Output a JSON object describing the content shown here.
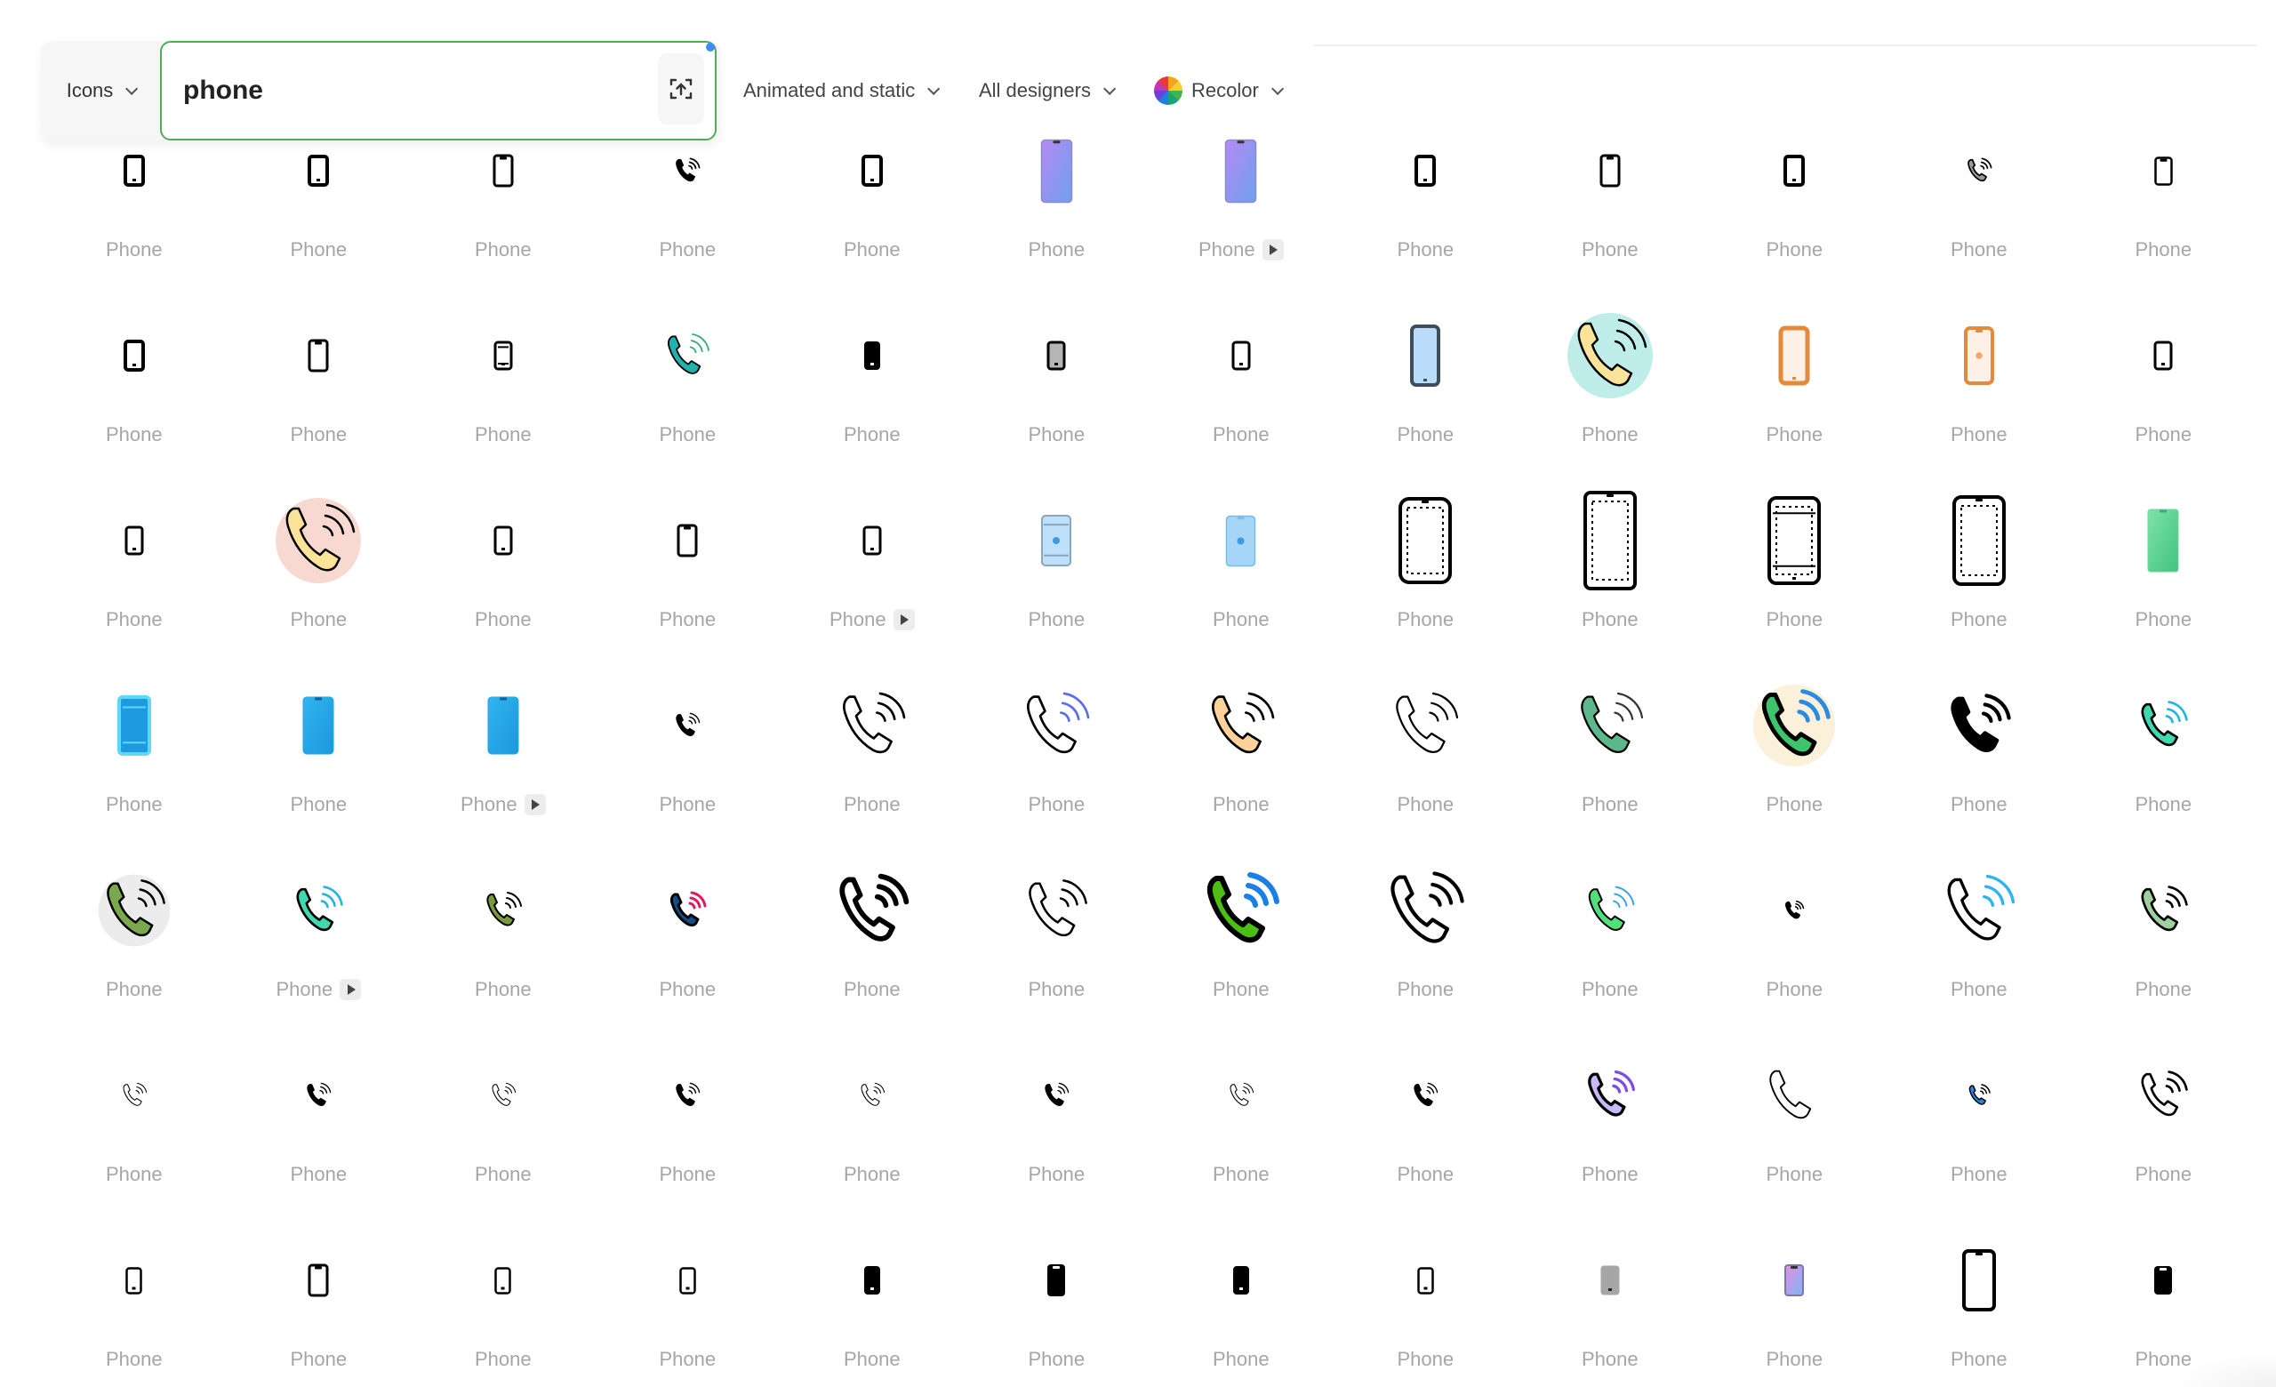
{
  "toolbar": {
    "type_select": "Icons",
    "search": {
      "value": "phone",
      "placeholder": ""
    },
    "upload_icon": "upload-image-icon",
    "filters": [
      {
        "label": "Animated and static"
      },
      {
        "label": "All designers"
      },
      {
        "label": "Recolor",
        "icon": "color-wheel-icon"
      }
    ]
  },
  "accent": {
    "search_border": "#4caf50",
    "notify_dot": "#3d8ef0",
    "label_color": "#a6a6a6"
  },
  "results": [
    {
      "label": "Phone",
      "style": "smartphone-solid"
    },
    {
      "label": "Phone",
      "style": "smartphone-solid"
    },
    {
      "label": "Phone",
      "style": "smartphone-notch-outline"
    },
    {
      "label": "Phone",
      "style": "handset-waves-solid"
    },
    {
      "label": "Phone",
      "style": "smartphone-solid"
    },
    {
      "label": "Phone",
      "style": "smartphone-gradient-purple"
    },
    {
      "label": "Phone",
      "style": "smartphone-gradient-purple",
      "animated": true
    },
    {
      "label": "Phone",
      "style": "smartphone-solid"
    },
    {
      "label": "Phone",
      "style": "smartphone-notch-outline"
    },
    {
      "label": "Phone",
      "style": "smartphone-solid"
    },
    {
      "label": "Phone",
      "style": "handset-waves-gray"
    },
    {
      "label": "Phone",
      "style": "smartphone-outline-thin"
    },
    {
      "label": "Phone",
      "style": "smartphone-solid"
    },
    {
      "label": "Phone",
      "style": "smartphone-notch-outline"
    },
    {
      "label": "Phone",
      "style": "smartphone-keypad"
    },
    {
      "label": "Phone",
      "style": "handset-waves-teal"
    },
    {
      "label": "Phone",
      "style": "smartphone-filled-black"
    },
    {
      "label": "Phone",
      "style": "smartphone-gray-screen"
    },
    {
      "label": "Phone",
      "style": "smartphone-outline-small"
    },
    {
      "label": "Phone",
      "style": "smartphone-blue-screen"
    },
    {
      "label": "Phone",
      "style": "handset-clouds-yellow"
    },
    {
      "label": "Phone",
      "style": "smartphone-orange"
    },
    {
      "label": "Phone",
      "style": "smartphone-orange-apple"
    },
    {
      "label": "Phone",
      "style": "smartphone-outline-small"
    },
    {
      "label": "Phone",
      "style": "smartphone-outline-small"
    },
    {
      "label": "Phone",
      "style": "handset-pink-circle"
    },
    {
      "label": "Phone",
      "style": "smartphone-outline-small"
    },
    {
      "label": "Phone",
      "style": "smartphone-notch-outline"
    },
    {
      "label": "Phone",
      "style": "smartphone-outline-small",
      "animated": true
    },
    {
      "label": "Phone",
      "style": "smartphone-lightblue-apple"
    },
    {
      "label": "Phone",
      "style": "smartphone-lightblue-apple-notch"
    },
    {
      "label": "Phone",
      "style": "smartphone-dashed-large"
    },
    {
      "label": "Phone",
      "style": "smartphone-dashed-waterdrop"
    },
    {
      "label": "Phone",
      "style": "smartphone-dashed-home"
    },
    {
      "label": "Phone",
      "style": "smartphone-dashed-notch"
    },
    {
      "label": "Phone",
      "style": "smartphone-green-gradient"
    },
    {
      "label": "Phone",
      "style": "smartphone-cyan"
    },
    {
      "label": "Phone",
      "style": "smartphone-blue-notch"
    },
    {
      "label": "Phone",
      "style": "smartphone-blue-notch",
      "animated": true
    },
    {
      "label": "Phone",
      "style": "handset-waves-small"
    },
    {
      "label": "Phone",
      "style": "handset-sparkle-outline"
    },
    {
      "label": "Phone",
      "style": "handset-gradient-purple"
    },
    {
      "label": "Phone",
      "style": "handset-sparkle-peach"
    },
    {
      "label": "Phone",
      "style": "handset-waves-outline"
    },
    {
      "label": "Phone",
      "style": "handset-waves-green"
    },
    {
      "label": "Phone",
      "style": "handset-green-blue-cream"
    },
    {
      "label": "Phone",
      "style": "handset-waves-black"
    },
    {
      "label": "Phone",
      "style": "handset-teal-flat"
    },
    {
      "label": "Phone",
      "style": "handset-sticker-green"
    },
    {
      "label": "Phone",
      "style": "handset-teal-flat",
      "animated": true
    },
    {
      "label": "Phone",
      "style": "handset-olive"
    },
    {
      "label": "Phone",
      "style": "handset-navy-red"
    },
    {
      "label": "Phone",
      "style": "handset-bold-outline"
    },
    {
      "label": "Phone",
      "style": "handset-thin-outline"
    },
    {
      "label": "Phone",
      "style": "handset-green-blue-shadow"
    },
    {
      "label": "Phone",
      "style": "handset-sketch"
    },
    {
      "label": "Phone",
      "style": "handset-green-3d"
    },
    {
      "label": "Phone",
      "style": "handset-waves-tiny"
    },
    {
      "label": "Phone",
      "style": "handset-neon-green"
    },
    {
      "label": "Phone",
      "style": "handset-navy-duotone"
    },
    {
      "label": "Phone",
      "style": "handset-waves-thin"
    },
    {
      "label": "Phone",
      "style": "handset-waves-small"
    },
    {
      "label": "Phone",
      "style": "handset-waves-thin"
    },
    {
      "label": "Phone",
      "style": "handset-waves-small"
    },
    {
      "label": "Phone",
      "style": "handset-waves-thin"
    },
    {
      "label": "Phone",
      "style": "handset-waves-small"
    },
    {
      "label": "Phone",
      "style": "handset-waves-thin"
    },
    {
      "label": "Phone",
      "style": "handset-waves-small"
    },
    {
      "label": "Phone",
      "style": "handset-gradient-violet"
    },
    {
      "label": "Phone",
      "style": "handset-isometric"
    },
    {
      "label": "Phone",
      "style": "handset-blue-tiny"
    },
    {
      "label": "Phone",
      "style": "handset-line-waves"
    },
    {
      "label": "Phone",
      "style": "smartphone-outline-tiny"
    },
    {
      "label": "Phone",
      "style": "smartphone-notch-outline"
    },
    {
      "label": "Phone",
      "style": "smartphone-outline-tiny"
    },
    {
      "label": "Phone",
      "style": "smartphone-outline-tiny"
    },
    {
      "label": "Phone",
      "style": "smartphone-filled-black"
    },
    {
      "label": "Phone",
      "style": "smartphone-filled-black-notch"
    },
    {
      "label": "Phone",
      "style": "smartphone-filled-black"
    },
    {
      "label": "Phone",
      "style": "smartphone-outline-tiny"
    },
    {
      "label": "Phone",
      "style": "smartphone-gray-filled"
    },
    {
      "label": "Phone",
      "style": "smartphone-gradient-pink"
    },
    {
      "label": "Phone",
      "style": "smartphone-outline-large"
    },
    {
      "label": "Phone",
      "style": "smartphone-filled-black-island"
    }
  ]
}
